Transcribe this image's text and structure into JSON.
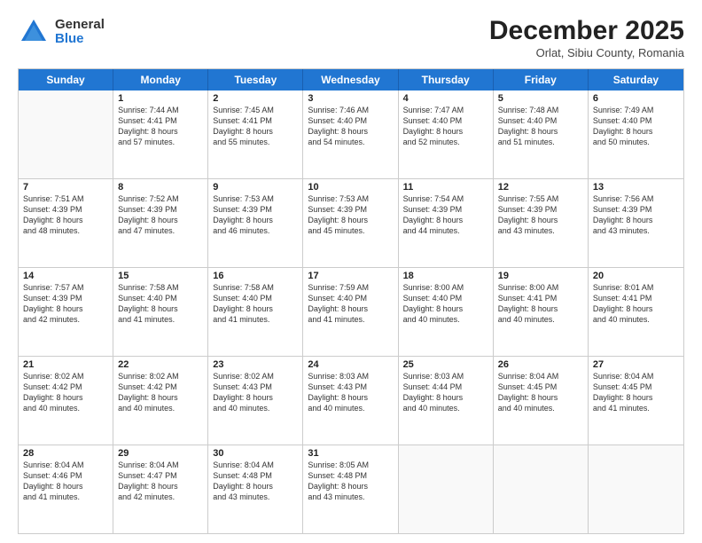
{
  "header": {
    "logo_general": "General",
    "logo_blue": "Blue",
    "month_title": "December 2025",
    "location": "Orlat, Sibiu County, Romania"
  },
  "weekdays": [
    "Sunday",
    "Monday",
    "Tuesday",
    "Wednesday",
    "Thursday",
    "Friday",
    "Saturday"
  ],
  "rows": [
    [
      {
        "day": "",
        "empty": true
      },
      {
        "day": "1",
        "lines": [
          "Sunrise: 7:44 AM",
          "Sunset: 4:41 PM",
          "Daylight: 8 hours",
          "and 57 minutes."
        ]
      },
      {
        "day": "2",
        "lines": [
          "Sunrise: 7:45 AM",
          "Sunset: 4:41 PM",
          "Daylight: 8 hours",
          "and 55 minutes."
        ]
      },
      {
        "day": "3",
        "lines": [
          "Sunrise: 7:46 AM",
          "Sunset: 4:40 PM",
          "Daylight: 8 hours",
          "and 54 minutes."
        ]
      },
      {
        "day": "4",
        "lines": [
          "Sunrise: 7:47 AM",
          "Sunset: 4:40 PM",
          "Daylight: 8 hours",
          "and 52 minutes."
        ]
      },
      {
        "day": "5",
        "lines": [
          "Sunrise: 7:48 AM",
          "Sunset: 4:40 PM",
          "Daylight: 8 hours",
          "and 51 minutes."
        ]
      },
      {
        "day": "6",
        "lines": [
          "Sunrise: 7:49 AM",
          "Sunset: 4:40 PM",
          "Daylight: 8 hours",
          "and 50 minutes."
        ]
      }
    ],
    [
      {
        "day": "7",
        "lines": [
          "Sunrise: 7:51 AM",
          "Sunset: 4:39 PM",
          "Daylight: 8 hours",
          "and 48 minutes."
        ]
      },
      {
        "day": "8",
        "lines": [
          "Sunrise: 7:52 AM",
          "Sunset: 4:39 PM",
          "Daylight: 8 hours",
          "and 47 minutes."
        ]
      },
      {
        "day": "9",
        "lines": [
          "Sunrise: 7:53 AM",
          "Sunset: 4:39 PM",
          "Daylight: 8 hours",
          "and 46 minutes."
        ]
      },
      {
        "day": "10",
        "lines": [
          "Sunrise: 7:53 AM",
          "Sunset: 4:39 PM",
          "Daylight: 8 hours",
          "and 45 minutes."
        ]
      },
      {
        "day": "11",
        "lines": [
          "Sunrise: 7:54 AM",
          "Sunset: 4:39 PM",
          "Daylight: 8 hours",
          "and 44 minutes."
        ]
      },
      {
        "day": "12",
        "lines": [
          "Sunrise: 7:55 AM",
          "Sunset: 4:39 PM",
          "Daylight: 8 hours",
          "and 43 minutes."
        ]
      },
      {
        "day": "13",
        "lines": [
          "Sunrise: 7:56 AM",
          "Sunset: 4:39 PM",
          "Daylight: 8 hours",
          "and 43 minutes."
        ]
      }
    ],
    [
      {
        "day": "14",
        "lines": [
          "Sunrise: 7:57 AM",
          "Sunset: 4:39 PM",
          "Daylight: 8 hours",
          "and 42 minutes."
        ]
      },
      {
        "day": "15",
        "lines": [
          "Sunrise: 7:58 AM",
          "Sunset: 4:40 PM",
          "Daylight: 8 hours",
          "and 41 minutes."
        ]
      },
      {
        "day": "16",
        "lines": [
          "Sunrise: 7:58 AM",
          "Sunset: 4:40 PM",
          "Daylight: 8 hours",
          "and 41 minutes."
        ]
      },
      {
        "day": "17",
        "lines": [
          "Sunrise: 7:59 AM",
          "Sunset: 4:40 PM",
          "Daylight: 8 hours",
          "and 41 minutes."
        ]
      },
      {
        "day": "18",
        "lines": [
          "Sunrise: 8:00 AM",
          "Sunset: 4:40 PM",
          "Daylight: 8 hours",
          "and 40 minutes."
        ]
      },
      {
        "day": "19",
        "lines": [
          "Sunrise: 8:00 AM",
          "Sunset: 4:41 PM",
          "Daylight: 8 hours",
          "and 40 minutes."
        ]
      },
      {
        "day": "20",
        "lines": [
          "Sunrise: 8:01 AM",
          "Sunset: 4:41 PM",
          "Daylight: 8 hours",
          "and 40 minutes."
        ]
      }
    ],
    [
      {
        "day": "21",
        "lines": [
          "Sunrise: 8:02 AM",
          "Sunset: 4:42 PM",
          "Daylight: 8 hours",
          "and 40 minutes."
        ]
      },
      {
        "day": "22",
        "lines": [
          "Sunrise: 8:02 AM",
          "Sunset: 4:42 PM",
          "Daylight: 8 hours",
          "and 40 minutes."
        ]
      },
      {
        "day": "23",
        "lines": [
          "Sunrise: 8:02 AM",
          "Sunset: 4:43 PM",
          "Daylight: 8 hours",
          "and 40 minutes."
        ]
      },
      {
        "day": "24",
        "lines": [
          "Sunrise: 8:03 AM",
          "Sunset: 4:43 PM",
          "Daylight: 8 hours",
          "and 40 minutes."
        ]
      },
      {
        "day": "25",
        "lines": [
          "Sunrise: 8:03 AM",
          "Sunset: 4:44 PM",
          "Daylight: 8 hours",
          "and 40 minutes."
        ]
      },
      {
        "day": "26",
        "lines": [
          "Sunrise: 8:04 AM",
          "Sunset: 4:45 PM",
          "Daylight: 8 hours",
          "and 40 minutes."
        ]
      },
      {
        "day": "27",
        "lines": [
          "Sunrise: 8:04 AM",
          "Sunset: 4:45 PM",
          "Daylight: 8 hours",
          "and 41 minutes."
        ]
      }
    ],
    [
      {
        "day": "28",
        "lines": [
          "Sunrise: 8:04 AM",
          "Sunset: 4:46 PM",
          "Daylight: 8 hours",
          "and 41 minutes."
        ]
      },
      {
        "day": "29",
        "lines": [
          "Sunrise: 8:04 AM",
          "Sunset: 4:47 PM",
          "Daylight: 8 hours",
          "and 42 minutes."
        ]
      },
      {
        "day": "30",
        "lines": [
          "Sunrise: 8:04 AM",
          "Sunset: 4:48 PM",
          "Daylight: 8 hours",
          "and 43 minutes."
        ]
      },
      {
        "day": "31",
        "lines": [
          "Sunrise: 8:05 AM",
          "Sunset: 4:48 PM",
          "Daylight: 8 hours",
          "and 43 minutes."
        ]
      },
      {
        "day": "",
        "empty": true
      },
      {
        "day": "",
        "empty": true
      },
      {
        "day": "",
        "empty": true
      }
    ]
  ]
}
